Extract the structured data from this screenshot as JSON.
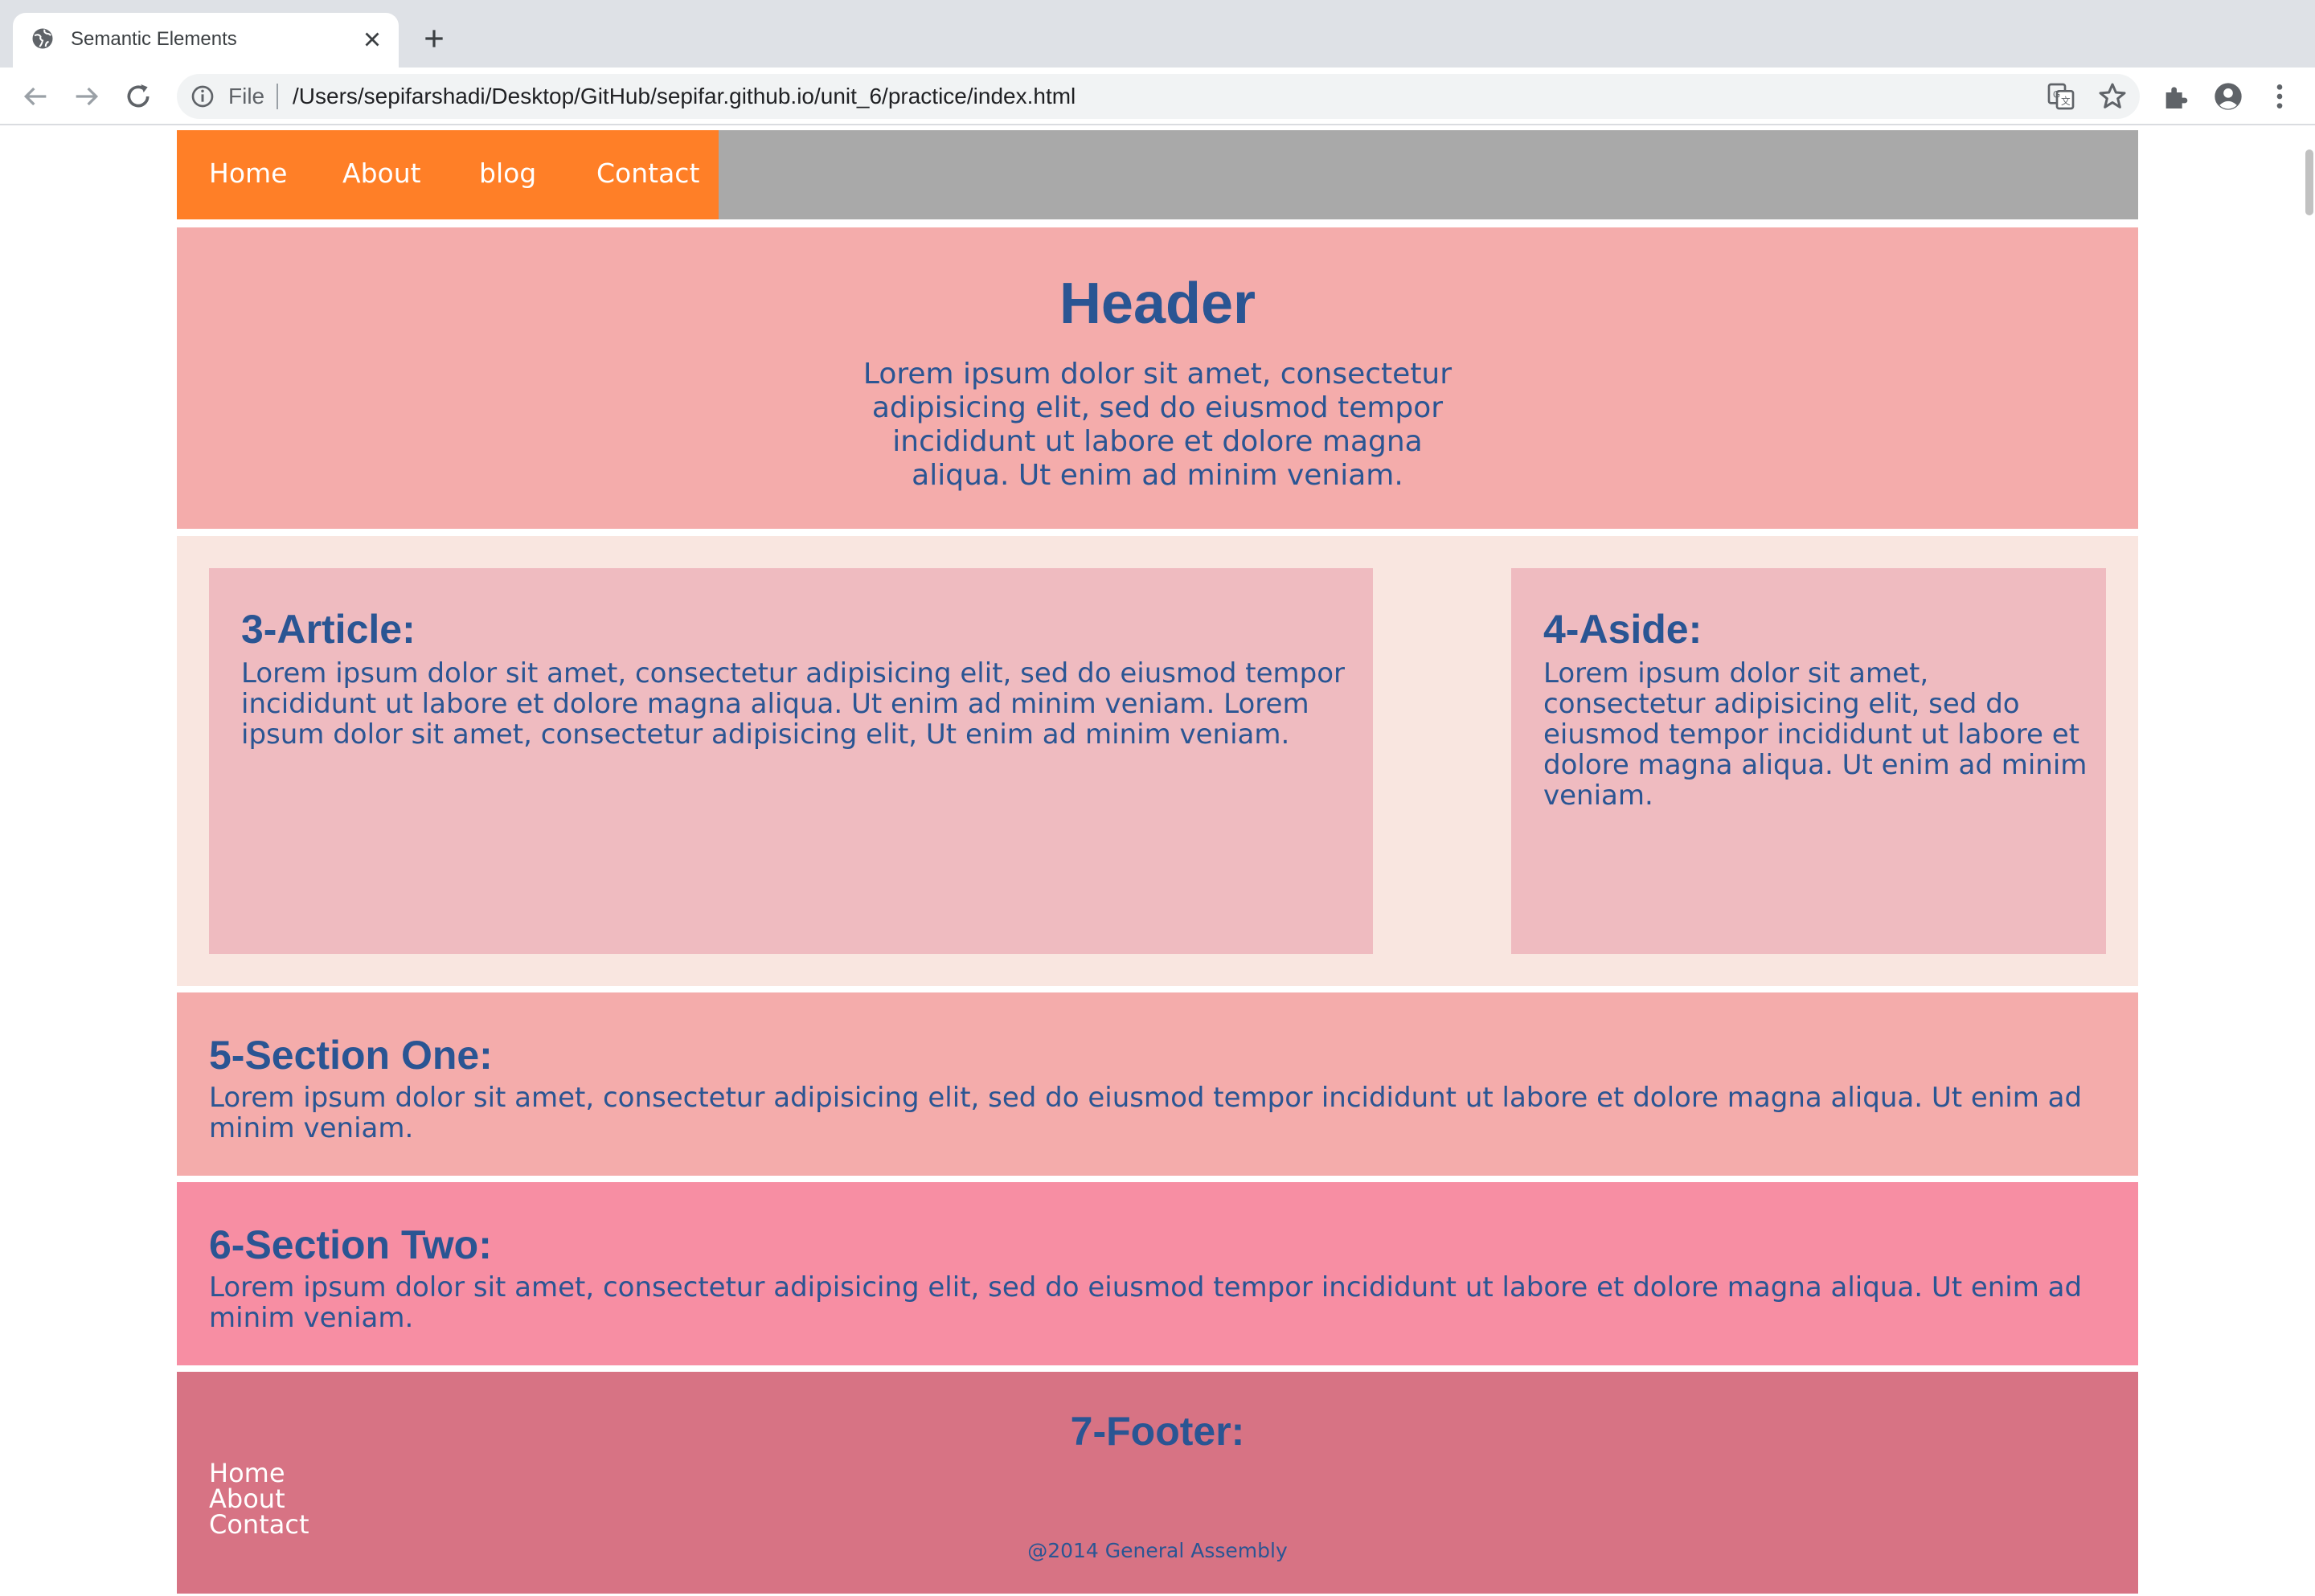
{
  "browser": {
    "tab_title": "Semantic Elements",
    "file_label": "File",
    "url": "/Users/sepifarshadi/Desktop/GitHub/sepifar.github.io/unit_6/practice/index.html"
  },
  "site": {
    "nav": {
      "items": [
        {
          "label": "Home"
        },
        {
          "label": "About"
        },
        {
          "label": "blog"
        },
        {
          "label": "Contact"
        }
      ]
    },
    "header": {
      "title": "Header",
      "text": "Lorem ipsum dolor sit amet, consectetur adipisicing elit, sed do eiusmod tempor incididunt ut labore et dolore magna aliqua. Ut enim ad minim veniam."
    },
    "article": {
      "title": "3-Article:",
      "text": "Lorem ipsum dolor sit amet, consectetur adipisicing elit, sed do eiusmod tempor incididunt ut labore et dolore magna aliqua. Ut enim ad minim veniam. Lorem ipsum dolor sit amet, consectetur adipisicing elit, Ut enim ad minim veniam."
    },
    "aside": {
      "title": "4-Aside:",
      "text": "Lorem ipsum dolor sit amet, consectetur adipisicing elit, sed do eiusmod tempor incididunt ut labore et dolore magna aliqua. Ut enim ad minim veniam."
    },
    "section_one": {
      "title": "5-Section One:",
      "text": "Lorem ipsum dolor sit amet, consectetur adipisicing elit, sed do eiusmod tempor incididunt ut labore et dolore magna aliqua. Ut enim ad minim veniam."
    },
    "section_two": {
      "title": "6-Section Two:",
      "text": "Lorem ipsum dolor sit amet, consectetur adipisicing elit, sed do eiusmod tempor incididunt ut labore et dolore magna aliqua. Ut enim ad minim veniam."
    },
    "footer": {
      "title": "7-Footer:",
      "links": [
        {
          "label": "Home"
        },
        {
          "label": "About"
        },
        {
          "label": "Contact"
        }
      ],
      "copyright": "@2014 General Assembly"
    }
  },
  "colors": {
    "nav_orange": "#ff7f27",
    "nav_gray": "#a9a9a9",
    "header_bg": "#f4acab",
    "main_bg": "#f9e6e0",
    "box_bg": "#efbbc0",
    "section_two_bg": "#f78ea3",
    "footer_bg": "#d77384",
    "text_blue": "#2a5593"
  },
  "icons": [
    "globe-icon",
    "close-icon",
    "plus-icon",
    "back-icon",
    "forward-icon",
    "reload-icon",
    "info-icon",
    "translate-icon",
    "star-icon",
    "extensions-icon",
    "profile-icon",
    "menu-icon"
  ]
}
